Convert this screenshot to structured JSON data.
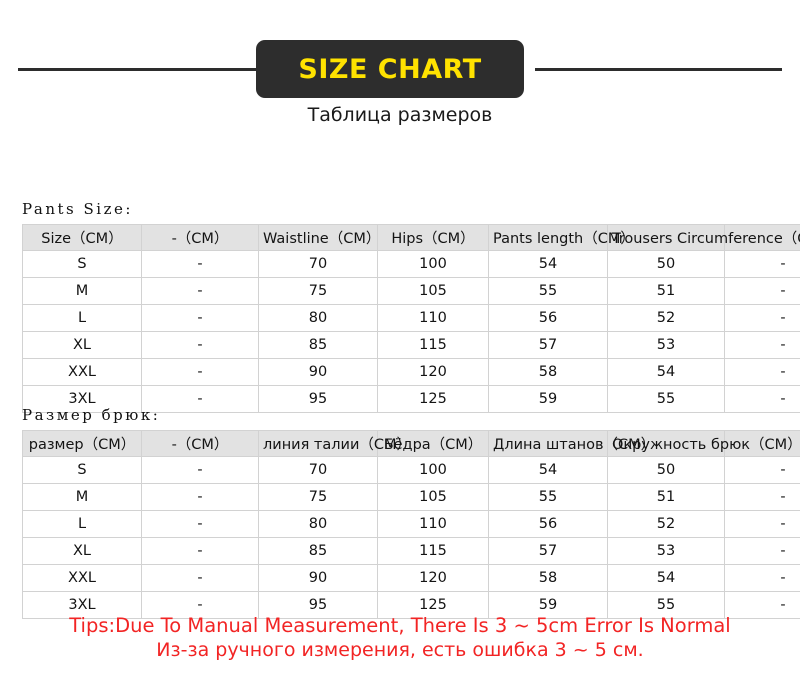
{
  "banner": {
    "title": "SIZE CHART",
    "subtitle": "Таблица размеров",
    "badge_color": "#2d2d2d",
    "title_color": "#ffe200",
    "rule_color": "#2d2d2d"
  },
  "sections": [
    {
      "caption": "Pants Size:",
      "headers": [
        "Size（CM）",
        "-（CM）",
        "Waistline（CM）",
        "Hips（CM）",
        "Pants length（CM）",
        "Trousers Circumference（CM）",
        ""
      ],
      "rows": [
        [
          "S",
          "-",
          "70",
          "100",
          "54",
          "50",
          "-"
        ],
        [
          "M",
          "-",
          "75",
          "105",
          "55",
          "51",
          "-"
        ],
        [
          "L",
          "-",
          "80",
          "110",
          "56",
          "52",
          "-"
        ],
        [
          "XL",
          "-",
          "85",
          "115",
          "57",
          "53",
          "-"
        ],
        [
          "XXL",
          "-",
          "90",
          "120",
          "58",
          "54",
          "-"
        ],
        [
          "3XL",
          "-",
          "95",
          "125",
          "59",
          "55",
          "-"
        ]
      ]
    },
    {
      "caption": "Размер брюк:",
      "headers": [
        "размер（CM）",
        "-（CM）",
        "линия талии（CM）",
        "Бёдра（CM）",
        "Длина штанов（CM）",
        "Окружность брюк（CM）",
        ""
      ],
      "rows": [
        [
          "S",
          "-",
          "70",
          "100",
          "54",
          "50",
          "-"
        ],
        [
          "M",
          "-",
          "75",
          "105",
          "55",
          "51",
          "-"
        ],
        [
          "L",
          "-",
          "80",
          "110",
          "56",
          "52",
          "-"
        ],
        [
          "XL",
          "-",
          "85",
          "115",
          "57",
          "53",
          "-"
        ],
        [
          "XXL",
          "-",
          "90",
          "120",
          "58",
          "54",
          "-"
        ],
        [
          "3XL",
          "-",
          "95",
          "125",
          "59",
          "55",
          "-"
        ]
      ]
    }
  ],
  "tips": {
    "english": "Tips:Due To Manual Measurement, There Is 3 ~ 5cm Error Is Normal",
    "russian": "Из-за ручного измерения, есть ошибка 3 ~ 5 см.",
    "color": "#f22424"
  }
}
